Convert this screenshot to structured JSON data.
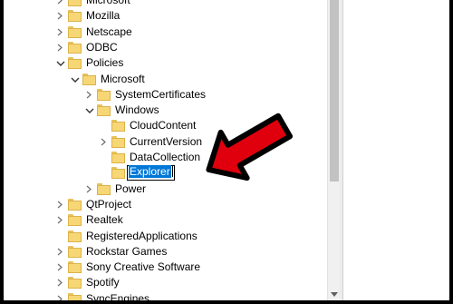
{
  "tree": {
    "items": [
      {
        "label": "Microsoft",
        "level": 1,
        "expander": "collapsed"
      },
      {
        "label": "Mozilla",
        "level": 1,
        "expander": "collapsed"
      },
      {
        "label": "Netscape",
        "level": 1,
        "expander": "collapsed"
      },
      {
        "label": "ODBC",
        "level": 1,
        "expander": "collapsed"
      },
      {
        "label": "Policies",
        "level": 1,
        "expander": "expanded"
      },
      {
        "label": "Microsoft",
        "level": 2,
        "expander": "expanded"
      },
      {
        "label": "SystemCertificates",
        "level": 3,
        "expander": "collapsed"
      },
      {
        "label": "Windows",
        "level": 3,
        "expander": "expanded"
      },
      {
        "label": "CloudContent",
        "level": 4,
        "expander": "none"
      },
      {
        "label": "CurrentVersion",
        "level": 4,
        "expander": "collapsed"
      },
      {
        "label": "DataCollection",
        "level": 4,
        "expander": "none"
      },
      {
        "label": "Explorer",
        "level": 4,
        "expander": "none",
        "editing": true
      },
      {
        "label": "Power",
        "level": 3,
        "expander": "collapsed"
      },
      {
        "label": "QtProject",
        "level": 1,
        "expander": "collapsed"
      },
      {
        "label": "Realtek",
        "level": 1,
        "expander": "collapsed"
      },
      {
        "label": "RegisteredApplications",
        "level": 1,
        "expander": "none"
      },
      {
        "label": "Rockstar Games",
        "level": 1,
        "expander": "collapsed"
      },
      {
        "label": "Sony Creative Software",
        "level": 1,
        "expander": "collapsed"
      },
      {
        "label": "Spotify",
        "level": 1,
        "expander": "collapsed"
      },
      {
        "label": "SyncEngines",
        "level": 1,
        "expander": "collapsed"
      }
    ]
  },
  "colors": {
    "folder": "#f7d775",
    "selection": "#0078d7",
    "arrow_fill": "#e0000d",
    "arrow_outline": "#000000"
  },
  "icons": {
    "expanded": "chevron-down-icon",
    "collapsed": "chevron-right-icon",
    "folder": "folder-icon",
    "annotation": "red-arrow-icon"
  }
}
